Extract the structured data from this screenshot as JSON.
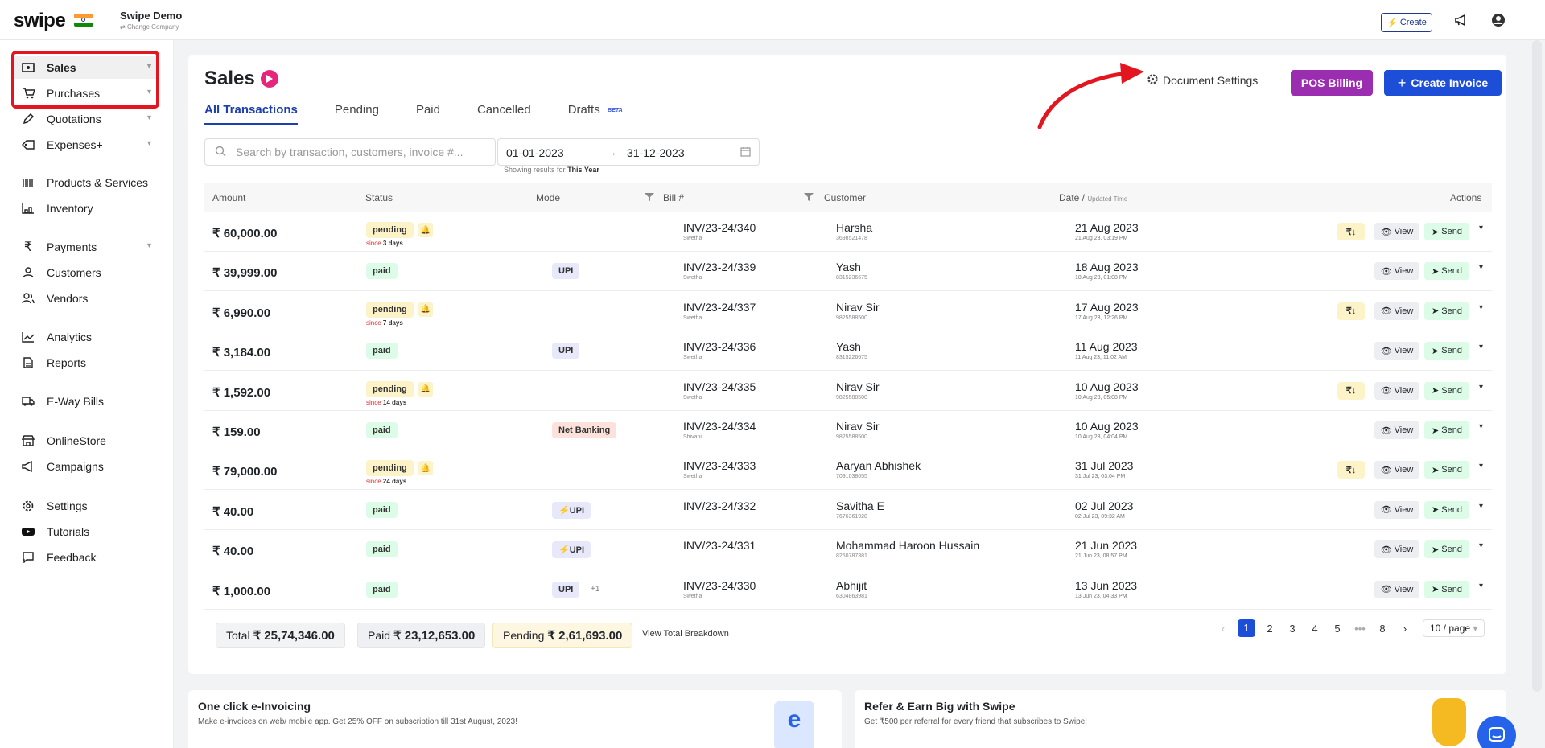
{
  "brand": {
    "name": "swipe",
    "company": "Swipe Demo",
    "change_company": "Change Company"
  },
  "topbar": {
    "create_label": "Create"
  },
  "sidebar": {
    "items": [
      {
        "label": "Sales",
        "icon": "cash-icon",
        "chev": true,
        "active": true
      },
      {
        "label": "Purchases",
        "icon": "cart-icon",
        "chev": true
      },
      {
        "label": "Quotations",
        "icon": "pencil-icon",
        "chev": true
      },
      {
        "label": "Expenses+",
        "icon": "tag-icon",
        "chev": true
      },
      {
        "label": "Products & Services",
        "icon": "barcode-icon"
      },
      {
        "label": "Inventory",
        "icon": "inventory-icon"
      },
      {
        "label": "Payments",
        "icon": "rupee-icon",
        "chev": true
      },
      {
        "label": "Customers",
        "icon": "user-icon"
      },
      {
        "label": "Vendors",
        "icon": "users-icon"
      },
      {
        "label": "Analytics",
        "icon": "chart-icon"
      },
      {
        "label": "Reports",
        "icon": "report-icon"
      },
      {
        "label": "E-Way Bills",
        "icon": "truck-icon"
      },
      {
        "label": "OnlineStore",
        "icon": "store-icon"
      },
      {
        "label": "Campaigns",
        "icon": "megaphone-icon"
      },
      {
        "label": "Settings",
        "icon": "gear-icon"
      },
      {
        "label": "Tutorials",
        "icon": "youtube-icon"
      },
      {
        "label": "Feedback",
        "icon": "message-icon"
      }
    ]
  },
  "main": {
    "title": "Sales",
    "tabs": [
      "All Transactions",
      "Pending",
      "Paid",
      "Cancelled",
      "Drafts"
    ],
    "beta": "BETA",
    "doc_settings": "Document Settings",
    "pos_billing": "POS Billing",
    "create_invoice": "Create Invoice",
    "search_placeholder": "Search by transaction, customers, invoice #...",
    "date_from": "01-01-2023",
    "date_to": "31-12-2023",
    "showing_prefix": "Showing results for",
    "showing_value": "This Year"
  },
  "table": {
    "headers": {
      "amount": "Amount",
      "status": "Status",
      "mode": "Mode",
      "bill": "Bill #",
      "customer": "Customer",
      "date": "Date /",
      "date_sub": "Updated Time",
      "actions": "Actions"
    },
    "rows": [
      {
        "amount": "₹ 60,000.00",
        "status": "pending",
        "since": "3 days",
        "mode": "",
        "bill": "INV/23-24/340",
        "bill_sub": "Swetha",
        "customer": "Harsha",
        "phone": "3698521478",
        "date": "21 Aug 2023",
        "date_sub": "21 Aug 23, 03:19 PM"
      },
      {
        "amount": "₹ 39,999.00",
        "status": "paid",
        "mode": "UPI",
        "bill": "INV/23-24/339",
        "bill_sub": "Swetha",
        "customer": "Yash",
        "phone": "8315236675",
        "date": "18 Aug 2023",
        "date_sub": "18 Aug 23, 01:08 PM"
      },
      {
        "amount": "₹ 6,990.00",
        "status": "pending",
        "since": "7 days",
        "mode": "",
        "bill": "INV/23-24/337",
        "bill_sub": "Swetha",
        "customer": "Nirav Sir",
        "phone": "9825588500",
        "date": "17 Aug 2023",
        "date_sub": "17 Aug 23, 12:26 PM"
      },
      {
        "amount": "₹ 3,184.00",
        "status": "paid",
        "mode": "UPI",
        "bill": "INV/23-24/336",
        "bill_sub": "Swetha",
        "customer": "Yash",
        "phone": "8315226675",
        "date": "11 Aug 2023",
        "date_sub": "11 Aug 23, 11:02 AM"
      },
      {
        "amount": "₹ 1,592.00",
        "status": "pending",
        "since": "14 days",
        "mode": "",
        "bill": "INV/23-24/335",
        "bill_sub": "Swetha",
        "customer": "Nirav Sir",
        "phone": "9825588500",
        "date": "10 Aug 2023",
        "date_sub": "10 Aug 23, 05:08 PM"
      },
      {
        "amount": "₹ 159.00",
        "status": "paid",
        "mode": "Net Banking",
        "bill": "INV/23-24/334",
        "bill_sub": "Shivani",
        "customer": "Nirav Sir",
        "phone": "9825588500",
        "date": "10 Aug 2023",
        "date_sub": "10 Aug 23, 04:04 PM"
      },
      {
        "amount": "₹ 79,000.00",
        "status": "pending",
        "since": "24 days",
        "mode": "",
        "bill": "INV/23-24/333",
        "bill_sub": "Swetha",
        "customer": "Aaryan Abhishek",
        "phone": "7091038055",
        "date": "31 Jul 2023",
        "date_sub": "31 Jul 23, 03:04 PM"
      },
      {
        "amount": "₹ 40.00",
        "status": "paid",
        "mode": "UPI",
        "bolt": true,
        "bill": "INV/23-24/332",
        "bill_sub": "",
        "customer": "Savitha E",
        "phone": "7676361928",
        "date": "02 Jul 2023",
        "date_sub": "02 Jul 23, 09:32 AM"
      },
      {
        "amount": "₹ 40.00",
        "status": "paid",
        "mode": "UPI",
        "bolt": true,
        "bill": "INV/23-24/331",
        "bill_sub": "",
        "customer": "Mohammad Haroon Hussain",
        "phone": "8260787381",
        "date": "21 Jun 2023",
        "date_sub": "21 Jun 23, 08:57 PM"
      },
      {
        "amount": "₹ 1,000.00",
        "status": "paid",
        "mode": "UPI",
        "mode_extra": "+1",
        "bill": "INV/23-24/330",
        "bill_sub": "Swetha",
        "customer": "Abhijit",
        "phone": "6304863981",
        "date": "13 Jun 2023",
        "date_sub": "13 Jun 23, 04:33 PM"
      }
    ],
    "since_prefix": "since",
    "view_label": "View",
    "send_label": "Send"
  },
  "totals": {
    "total_label": "Total",
    "total_value": "₹ 25,74,346.00",
    "paid_label": "Paid",
    "paid_value": "₹ 23,12,653.00",
    "pending_label": "Pending",
    "pending_value": "₹ 2,61,693.00",
    "breakdown_link": "View Total Breakdown"
  },
  "pagination": {
    "pages": [
      "1",
      "2",
      "3",
      "4",
      "5",
      "•••",
      "8"
    ],
    "current": "1",
    "page_size": "10 / page"
  },
  "promos": [
    {
      "title": "One click e-Invoicing",
      "sub": "Make e-invoices on web/ mobile app. Get 25% OFF on subscription till 31st August, 2023!"
    },
    {
      "title": "Refer & Earn Big with Swipe",
      "sub": "Get ₹500 per referral for every friend that subscribes to Swipe!"
    }
  ],
  "colors": {
    "primary": "#1d4ed8",
    "pos": "#9b2db0",
    "highlight": "#e3151f",
    "pending": "#fdf3c8",
    "paid": "#dcfce7"
  }
}
